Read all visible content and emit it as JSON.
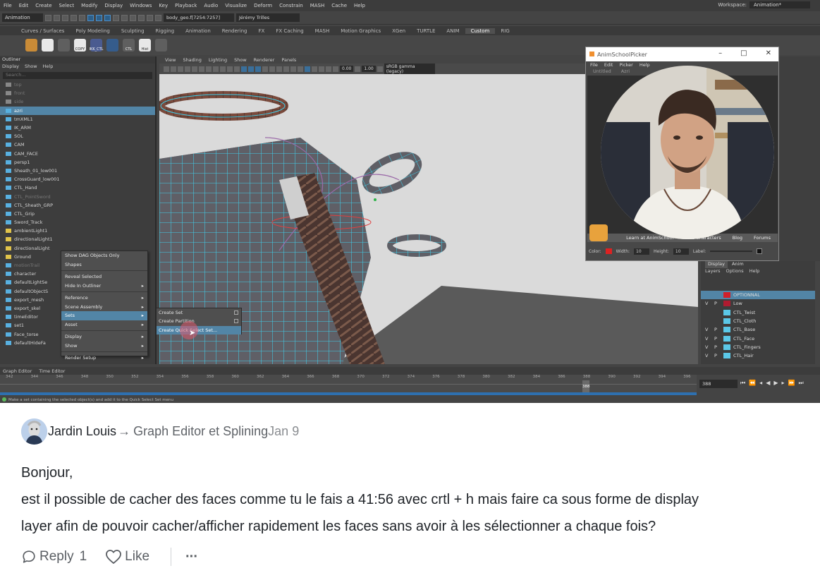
{
  "maya": {
    "menu": [
      "File",
      "Edit",
      "Create",
      "Select",
      "Modify",
      "Display",
      "Windows",
      "Key",
      "Playback",
      "Audio",
      "Visualize",
      "Deform",
      "Constrain",
      "MASH",
      "Cache",
      "Help"
    ],
    "workspace_label": "Workspace:",
    "workspace_value": "Animation*",
    "mode_select": "Animation",
    "field_object": "body_geo.f[7254:7257]",
    "user_name": "Jérémy Trilles",
    "shelf_tabs": [
      "Curves / Surfaces",
      "Poly Modeling",
      "Sculpting",
      "Rigging",
      "Animation",
      "Rendering",
      "FX",
      "FX Caching",
      "MASH",
      "Motion Graphics",
      "XGen",
      "TURTLE",
      "ANIM",
      "Custom",
      "RIG"
    ],
    "shelf_active": "Custom",
    "shelf_icons": [
      "COPY",
      "IKK_CTL",
      "CTL",
      "Hist"
    ],
    "outliner": {
      "title": "Outliner",
      "menu": [
        "Display",
        "Show",
        "Help"
      ],
      "search_placeholder": "Search...",
      "items": [
        "top",
        "front",
        "side",
        "azri",
        "tmXML1",
        "IK_ARM",
        "SOL",
        "CAM",
        "CAM_FACE",
        "persp1",
        "Sheath_01_low001",
        "CrossGuard_low001",
        "CTL_Hand",
        "CTL_PointSword",
        "CTL_Sheath_GRP",
        "CTL_Grip",
        "Sword_Track",
        "ambientLight1",
        "directionalLight1",
        "directionalLight",
        "Ground",
        "motionTrail",
        "character",
        "defaultLightSe",
        "defaultObjectS",
        "export_mesh",
        "export_skel",
        "timeEditor",
        "set1",
        "Face_torse",
        "defaultHideFa"
      ]
    },
    "context_menu": [
      "Show DAG Objects Only",
      "Shapes",
      "Reveal Selected",
      "Hide In Outliner",
      "Reference",
      "Scene Assembly",
      "Sets",
      "Asset",
      "Display",
      "Show",
      "Render Setup"
    ],
    "submenu": [
      "Create Set",
      "Create Partition",
      "Create Quick Select Set..."
    ],
    "viewport_menu": [
      "View",
      "Shading",
      "Lighting",
      "Show",
      "Renderer",
      "Panels"
    ],
    "viewport_values": [
      "0.00",
      "1.00"
    ],
    "gamma": "sRGB gamma (legacy)",
    "picker": {
      "title": "AnimSchoolPicker",
      "menu": [
        "File",
        "Edit",
        "Picker",
        "Help"
      ],
      "tabs": [
        "Untitled",
        "Azri"
      ],
      "footer": [
        "Learn at AnimSchool",
        "Free Characters",
        "Blog",
        "Forums"
      ],
      "controls": [
        "Color:",
        "Width:",
        "10",
        "Height:",
        "10",
        "Label:"
      ]
    },
    "layers": {
      "tabs": [
        "Display",
        "Anim"
      ],
      "menu": [
        "Layers",
        "Options",
        "Help"
      ],
      "rows": [
        {
          "v": "",
          "p": "",
          "name": "OPTIONNAL",
          "color": "#d0202a"
        },
        {
          "v": "V",
          "p": "P",
          "name": "Low",
          "color": "#b01b30"
        },
        {
          "v": "",
          "p": "",
          "name": "CTL_Twist",
          "color": "#5bc8e8"
        },
        {
          "v": "",
          "p": "",
          "name": "CTL_Cloth",
          "color": "#5bc8e8"
        },
        {
          "v": "V",
          "p": "P",
          "name": "CTL_Base",
          "color": "#5bc8e8"
        },
        {
          "v": "V",
          "p": "P",
          "name": "CTL_Face",
          "color": "#5bc8e8"
        },
        {
          "v": "V",
          "p": "P",
          "name": "CTL_Fingers",
          "color": "#5bc8e8"
        },
        {
          "v": "V",
          "p": "P",
          "name": "CTL_Hair",
          "color": "#5bc8e8"
        }
      ]
    },
    "graph_tabs": [
      "Graph Editor",
      "Time Editor"
    ],
    "timeline_ticks": [
      "342",
      "344",
      "346",
      "348",
      "350",
      "352",
      "354",
      "356",
      "358",
      "360",
      "362",
      "364",
      "366",
      "368",
      "370",
      "372",
      "374",
      "376",
      "378",
      "380",
      "382",
      "384",
      "386",
      "388",
      "390",
      "392",
      "394",
      "396"
    ],
    "current_frame": "388",
    "frame_field": "388",
    "help_line": "Make a set containing the selected object(s) and add it to the Quick Select Set menu"
  },
  "comment": {
    "author": "Jardin Louis",
    "arrow": "→",
    "chapter": "Graph Editor et Splining",
    "date": "Jan 9",
    "body_lines": [
      "Bonjour,",
      "est il possible de cacher des faces comme tu le fais a 41:56 avec crtl + h mais faire ca sous forme de display",
      "layer afin de pouvoir cacher/afficher rapidement les faces sans avoir à les sélectionner a chaque fois?"
    ],
    "reply_label": "Reply",
    "reply_count": "1",
    "like_label": "Like",
    "more_label": "···"
  }
}
